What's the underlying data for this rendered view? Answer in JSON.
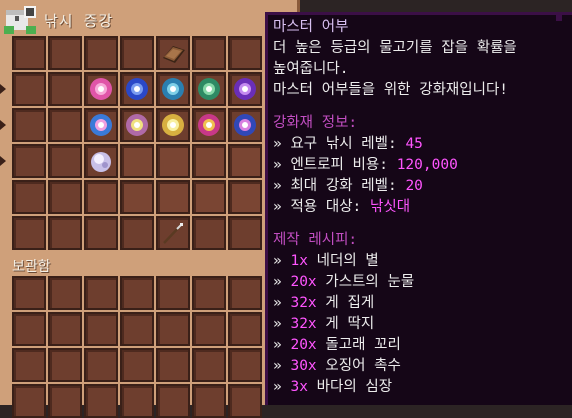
{
  "panel": {
    "title": "낚시 증강",
    "storage_label": "보관함"
  },
  "icons": {
    "chest": "chest-icon",
    "book": "book-icon",
    "bait": "bait-icon",
    "pearl": "pearl-icon",
    "rod": "fishing-rod-icon"
  },
  "colors": {
    "tooltip_bg": "#150617",
    "tooltip_border": "#3b0f46",
    "accent_magenta": "#ff55ff",
    "header_purple": "#c24ec2",
    "title_lavender": "#d7bff0"
  },
  "tooltip": {
    "title": "마스터 어부",
    "desc": [
      "더 높은 등급의 물고기를 잡을 확률을",
      "높여줍니다.",
      "마스터 어부들을 위한 강화재입니다!"
    ],
    "info_header": "강화재 정보:",
    "info": [
      {
        "label": "요구 낚시 레벨: ",
        "value": "45"
      },
      {
        "label": "엔트로피 비용: ",
        "value": "120,000"
      },
      {
        "label": "최대 강화 레벨: ",
        "value": "20"
      },
      {
        "label": "적용 대상: ",
        "value": "낚싯대"
      }
    ],
    "recipe_header": "제작 레시피:",
    "recipe": [
      {
        "qty": "1x",
        "name": "네더의 별"
      },
      {
        "qty": "20x",
        "name": "가스트의 눈물"
      },
      {
        "qty": "32x",
        "name": "게 집게"
      },
      {
        "qty": "32x",
        "name": "게 딱지"
      },
      {
        "qty": "20x",
        "name": "돌고래 꼬리"
      },
      {
        "qty": "30x",
        "name": "오징어 촉수"
      },
      {
        "qty": "3x",
        "name": "바다의 심장"
      }
    ],
    "bullet": "»"
  }
}
